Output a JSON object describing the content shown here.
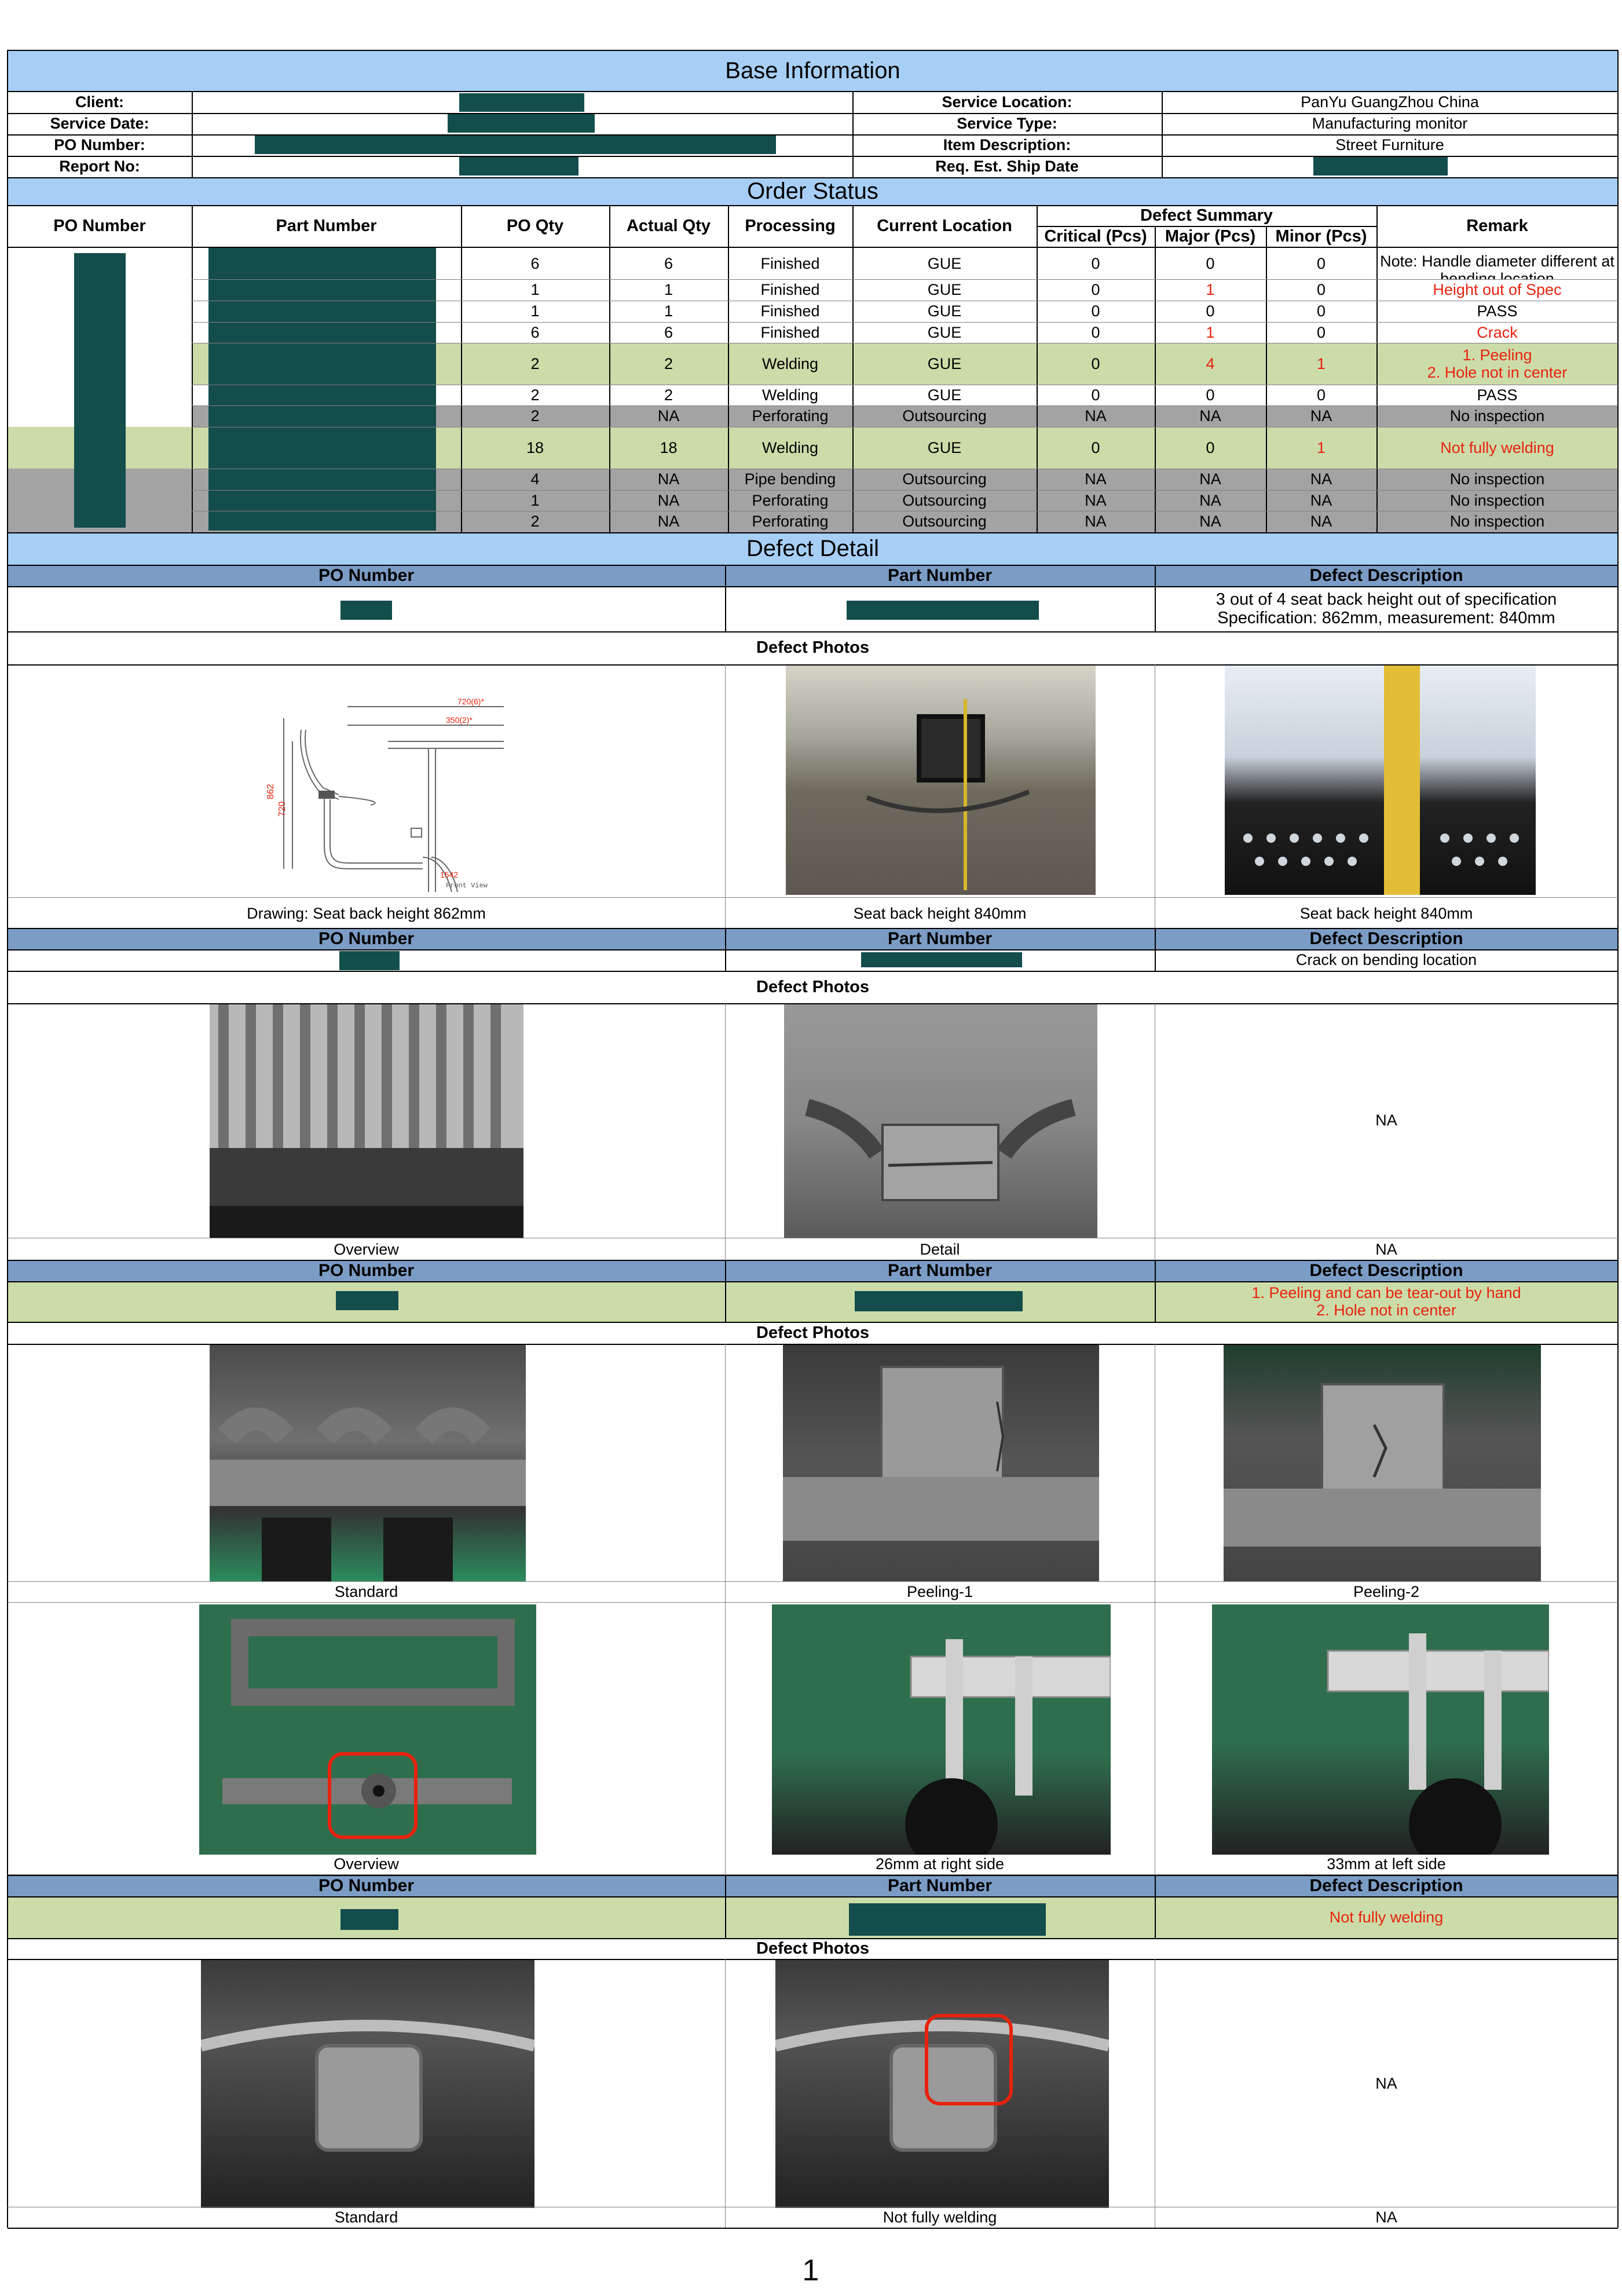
{
  "base_information": {
    "title": "Base Information",
    "client_label": "Client:",
    "service_date_label": "Service Date:",
    "po_number_label": "PO Number:",
    "report_no_label": "Report No:",
    "service_location_label": "Service Location:",
    "service_location": "PanYu GuangZhou China",
    "service_type_label": "Service Type:",
    "service_type": "Manufacturing monitor",
    "item_description_label": "Item Description:",
    "item_description": "Street Furniture",
    "ship_date_label": "Req. Est. Ship Date"
  },
  "order_status": {
    "title": "Order Status",
    "headers": {
      "po_number": "PO Number",
      "part_number": "Part Number",
      "po_qty": "PO Qty",
      "actual_qty": "Actual Qty",
      "processing": "Processing",
      "current_location": "Current Location",
      "defect_summary": "Defect Summary",
      "critical": "Critical (Pcs)",
      "major": "Major (Pcs)",
      "minor": "Minor (Pcs)",
      "remark": "Remark"
    },
    "rows": [
      {
        "po_qty": "6",
        "actual_qty": "6",
        "processing": "Finished",
        "location": "GUE",
        "critical": "0",
        "major": "0",
        "minor": "0",
        "remark": "Note: Handle diameter different at bending location"
      },
      {
        "po_qty": "1",
        "actual_qty": "1",
        "processing": "Finished",
        "location": "GUE",
        "critical": "0",
        "major": "1",
        "minor": "0",
        "remark": "Height out of Spec"
      },
      {
        "po_qty": "1",
        "actual_qty": "1",
        "processing": "Finished",
        "location": "GUE",
        "critical": "0",
        "major": "0",
        "minor": "0",
        "remark": "PASS"
      },
      {
        "po_qty": "6",
        "actual_qty": "6",
        "processing": "Finished",
        "location": "GUE",
        "critical": "0",
        "major": "1",
        "minor": "0",
        "remark": "Crack"
      },
      {
        "po_qty": "2",
        "actual_qty": "2",
        "processing": "Welding",
        "location": "GUE",
        "critical": "0",
        "major": "4",
        "minor": "1",
        "remark": "1. Peeling\n2. Hole not in center"
      },
      {
        "po_qty": "2",
        "actual_qty": "2",
        "processing": "Welding",
        "location": "GUE",
        "critical": "0",
        "major": "0",
        "minor": "0",
        "remark": "PASS"
      },
      {
        "po_qty": "2",
        "actual_qty": "NA",
        "processing": "Perforating",
        "location": "Outsourcing",
        "critical": "NA",
        "major": "NA",
        "minor": "NA",
        "remark": "No inspection"
      },
      {
        "po_qty": "18",
        "actual_qty": "18",
        "processing": "Welding",
        "location": "GUE",
        "critical": "0",
        "major": "0",
        "minor": "1",
        "remark": "Not fully welding"
      },
      {
        "po_qty": "4",
        "actual_qty": "NA",
        "processing": "Pipe bending",
        "location": "Outsourcing",
        "critical": "NA",
        "major": "NA",
        "minor": "NA",
        "remark": "No inspection"
      },
      {
        "po_qty": "1",
        "actual_qty": "NA",
        "processing": "Perforating",
        "location": "Outsourcing",
        "critical": "NA",
        "major": "NA",
        "minor": "NA",
        "remark": "No inspection"
      },
      {
        "po_qty": "2",
        "actual_qty": "NA",
        "processing": "Perforating",
        "location": "Outsourcing",
        "critical": "NA",
        "major": "NA",
        "minor": "NA",
        "remark": "No inspection"
      }
    ]
  },
  "defect_detail": {
    "title": "Defect Detail",
    "po_number_label": "PO Number",
    "part_number_label": "Part Number",
    "defect_description_label": "Defect Description",
    "defect_photos_label": "Defect Photos",
    "sections": [
      {
        "description": "3 out of 4 seat back height out of specification\nSpecification: 862mm, measurement: 840mm",
        "captions": [
          "Drawing: Seat back height 862mm",
          "Seat back height 840mm",
          "Seat back height 840mm"
        ],
        "drawing": {
          "dim1": "862",
          "dim2": "720",
          "top1": "720(6)*",
          "top2": "350(2)*",
          "bottom": "1542",
          "view": "Front View"
        }
      },
      {
        "description": "Crack on bending location",
        "captions": [
          "Overview",
          "Detail",
          "NA"
        ],
        "na": "NA"
      },
      {
        "description": "1. Peeling and can be tear-out by hand\n2. Hole not in center",
        "captions": [
          "Standard",
          "Peeling-1",
          "Peeling-2"
        ],
        "captions_row2": [
          "Overview",
          "26mm at right side",
          "33mm at left side"
        ]
      },
      {
        "description": "Not fully welding",
        "captions": [
          "Standard",
          "Not fully welding",
          "NA"
        ],
        "na": "NA"
      }
    ]
  },
  "page_number": "1",
  "colors": {
    "header_blue": "#a7cff6",
    "sub_header_blue": "#7b9cc5",
    "highlight_green": "#ccdca9",
    "grey_row": "#a3a3a3",
    "redaction": "#134d4c",
    "defect_red": "#e8220e"
  }
}
